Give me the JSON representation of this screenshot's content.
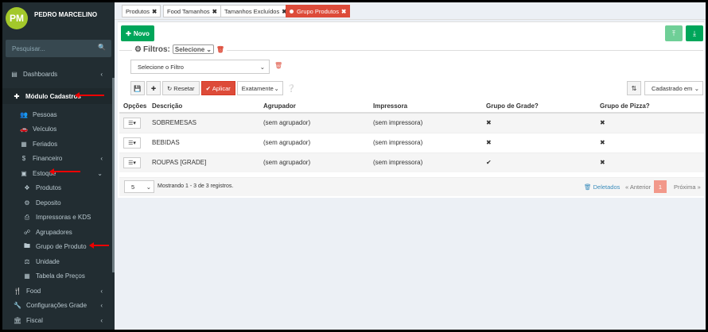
{
  "user": {
    "initials": "PM",
    "name": "PEDRO MARCELINO"
  },
  "search": {
    "placeholder": "Pesquisar..."
  },
  "menu": {
    "dashboards": "Dashboards",
    "modulo": "Módulo Cadastros",
    "pessoas": "Pessoas",
    "veiculos": "Veículos",
    "feriados": "Feriados",
    "financeiro": "Financeiro",
    "estoque": "Estoque",
    "produtos": "Produtos",
    "deposito": "Deposito",
    "impressoras": "Impressoras e KDS",
    "agrupadores": "Agrupadores",
    "grupo_produto": "Grupo de Produto",
    "unidade": "Unidade",
    "tabela_precos": "Tabela de Preços",
    "food": "Food",
    "config_grade": "Configurações Grade",
    "fiscal": "Fiscal"
  },
  "tabs": [
    "Produtos",
    "Food Tamanhos",
    "Tamanhos Excluídos",
    "Grupo Produtos"
  ],
  "toolbar": {
    "novo": "Novo",
    "filtros_label": "Filtros:",
    "filtros_select": "Selecione",
    "filter_placeholder": "Selecione o Filtro",
    "resetar": "Resetar",
    "aplicar": "Aplicar",
    "match_mode": "Exatamente",
    "sort_by": "Cadastrado em"
  },
  "table": {
    "headers": [
      "Opções",
      "Descrição",
      "Agrupador",
      "Impressora",
      "Grupo de Grade?",
      "Grupo de Pizza?"
    ],
    "rows": [
      {
        "descricao": "SOBREMESAS",
        "agrupador": "(sem agrupador)",
        "impressora": "(sem impressora)",
        "grade": "✖",
        "pizza": "✖"
      },
      {
        "descricao": "BEBIDAS",
        "agrupador": "(sem agrupador)",
        "impressora": "(sem impressora)",
        "grade": "✖",
        "pizza": "✖"
      },
      {
        "descricao": "ROUPAS [GRADE]",
        "agrupador": "(sem agrupador)",
        "impressora": "(sem impressora)",
        "grade": "✔",
        "pizza": "✖"
      }
    ]
  },
  "footer": {
    "page_size": "5",
    "records": "Mostrando 1 - 3 de 3 registros.",
    "deletados": "Deletados",
    "anterior": "« Anterior",
    "page": "1",
    "proxima": "Próxima »"
  },
  "colors": {
    "sidebar": "#222d32",
    "green": "#00a65a",
    "red": "#dd4b39",
    "avatar": "#a3c82b"
  }
}
